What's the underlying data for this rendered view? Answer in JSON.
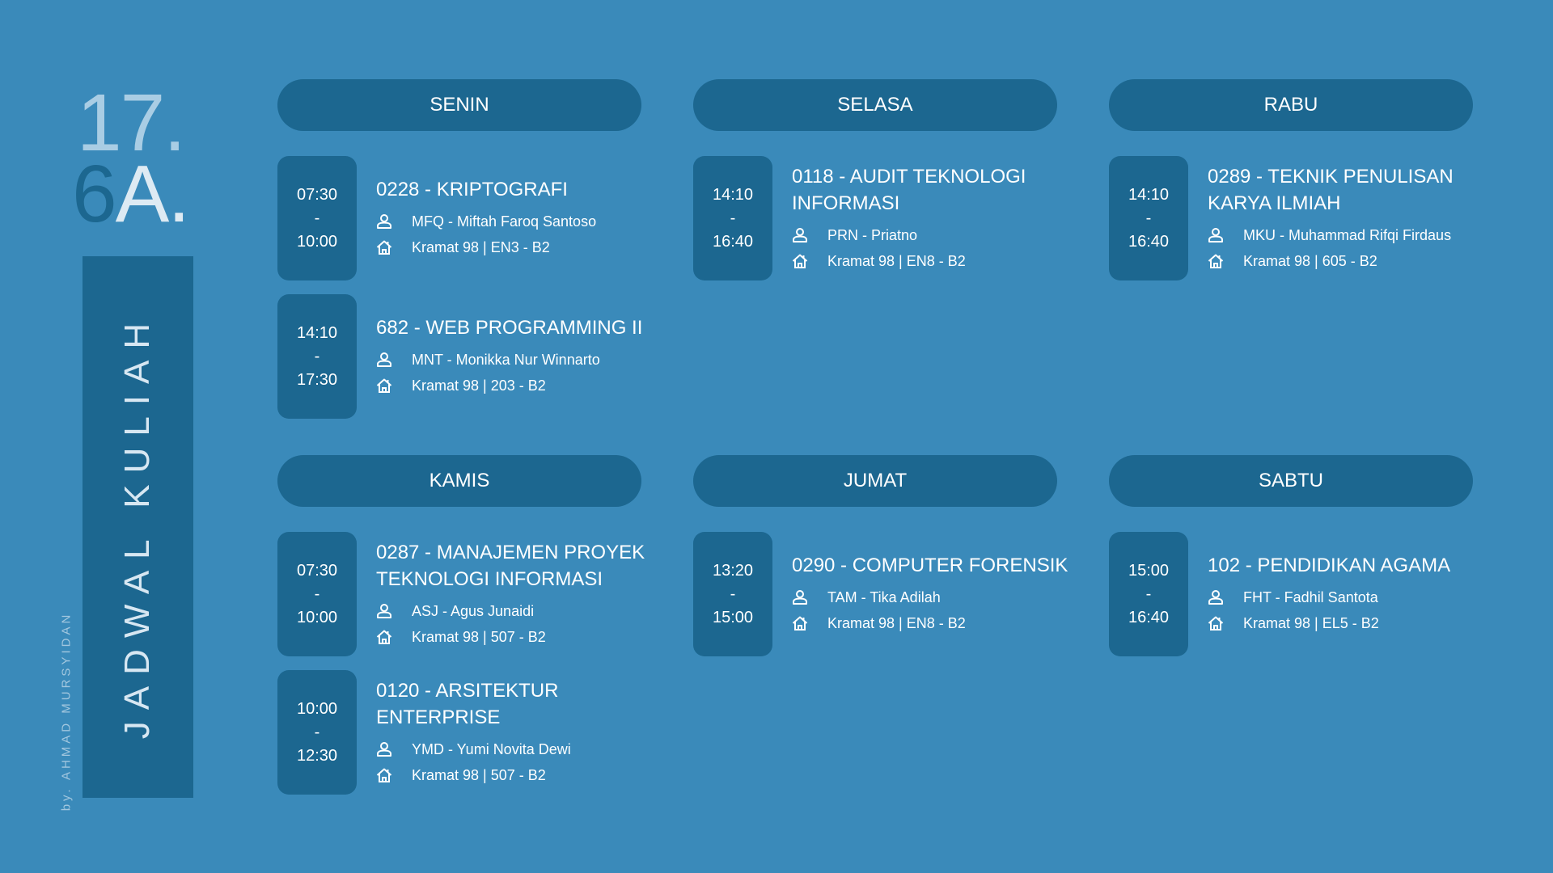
{
  "class_code": {
    "line1": "17.",
    "line2a": "6",
    "line2b": "A."
  },
  "side_title": "JADWAL KULIAH",
  "credit": "by. AHMAD MURSYIDAN",
  "colors": {
    "background": "#3a8aba",
    "panel": "#1c6790"
  },
  "days": {
    "senin": {
      "label": "SENIN",
      "courses": [
        {
          "start": "07:30",
          "sep": "-",
          "end": "10:00",
          "title": "0228 - KRIPTOGRAFI",
          "lecturer": "MFQ - Miftah Faroq Santoso",
          "room": "Kramat 98  |  EN3 - B2"
        },
        {
          "start": "14:10",
          "sep": "-",
          "end": "17:30",
          "title": "682 - WEB PROGRAMMING II",
          "lecturer": "MNT - Monikka Nur Winnarto",
          "room": "Kramat 98  |  203 - B2"
        }
      ]
    },
    "selasa": {
      "label": "SELASA",
      "courses": [
        {
          "start": "14:10",
          "sep": "-",
          "end": "16:40",
          "title": "0118 - AUDIT TEKNOLOGI INFORMASI",
          "lecturer": "PRN - Priatno",
          "room": "Kramat 98  |  EN8 - B2"
        }
      ]
    },
    "rabu": {
      "label": "RABU",
      "courses": [
        {
          "start": "14:10",
          "sep": "-",
          "end": "16:40",
          "title": "0289 - TEKNIK PENULISAN KARYA ILMIAH",
          "lecturer": "MKU - Muhammad Rifqi Firdaus",
          "room": "Kramat 98  |  605 - B2"
        }
      ]
    },
    "kamis": {
      "label": "KAMIS",
      "courses": [
        {
          "start": "07:30",
          "sep": "-",
          "end": "10:00",
          "title": "0287 - MANAJEMEN PROYEK TEKNOLOGI INFORMASI",
          "lecturer": "ASJ - Agus Junaidi",
          "room": "Kramat 98  |  507 - B2"
        },
        {
          "start": "10:00",
          "sep": "-",
          "end": "12:30",
          "title": "0120 - ARSITEKTUR ENTERPRISE",
          "lecturer": "YMD - Yumi Novita Dewi",
          "room": "Kramat 98  |  507 - B2"
        }
      ]
    },
    "jumat": {
      "label": "JUMAT",
      "courses": [
        {
          "start": "13:20",
          "sep": "-",
          "end": "15:00",
          "title": "0290 - COMPUTER FORENSIK",
          "lecturer": "TAM - Tika Adilah",
          "room": "Kramat 98  |  EN8 - B2"
        }
      ]
    },
    "sabtu": {
      "label": "SABTU",
      "courses": [
        {
          "start": "15:00",
          "sep": "-",
          "end": "16:40",
          "title": "102 - PENDIDIKAN AGAMA",
          "lecturer": "FHT - Fadhil Santota",
          "room": "Kramat 98  |  EL5 - B2"
        }
      ]
    }
  }
}
